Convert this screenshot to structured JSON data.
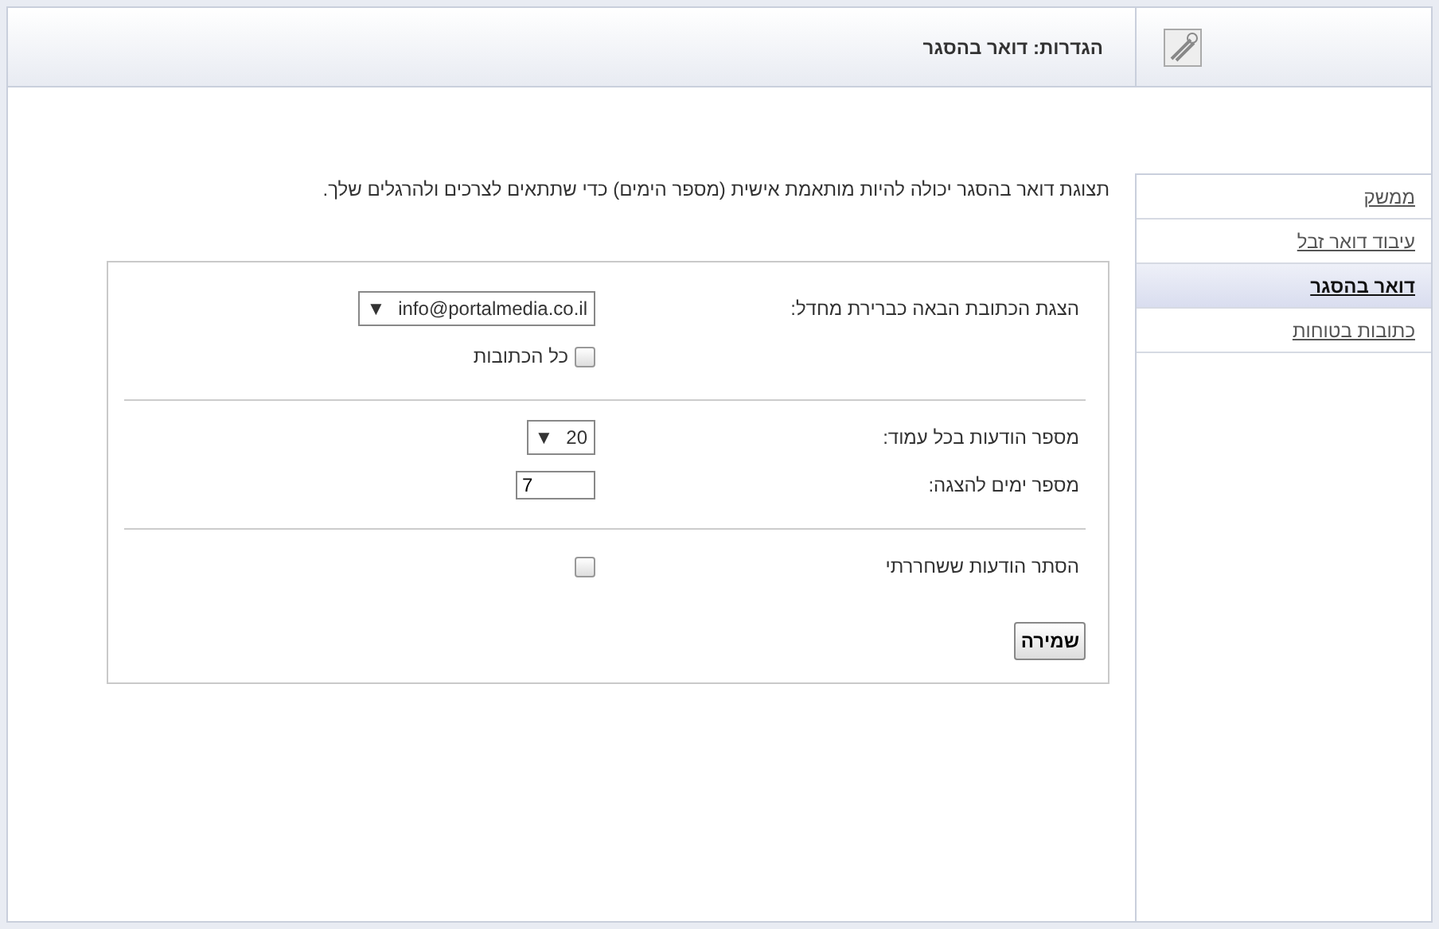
{
  "header": {
    "title": "הגדרות: דואר בהסגר"
  },
  "sidebar": {
    "items": [
      {
        "label": "ממשק",
        "selected": false
      },
      {
        "label": "עיבוד דואר זבל",
        "selected": false
      },
      {
        "label": "דואר בהסגר",
        "selected": true
      },
      {
        "label": "כתובות בטוחות",
        "selected": false
      }
    ]
  },
  "intro": "תצוגת דואר בהסגר יכולה להיות מותאמת אישית (מספר הימים) כדי שתתאים לצרכים ולהרגלים שלך.",
  "form": {
    "sections": [
      [
        {
          "kind": "select",
          "label": "הצגת הכתובת הבאה כברירת מחדל:",
          "value": "info@portalmedia.co.il",
          "arrow": "▼"
        },
        {
          "kind": "checkbox",
          "text": "כל הכתובות",
          "checked": false
        }
      ],
      [
        {
          "kind": "select",
          "label": "מספר הודעות בכל עמוד:",
          "value": "20",
          "arrow": "▼"
        },
        {
          "kind": "text",
          "label": "מספר ימים להצגה:",
          "value": "7"
        }
      ],
      [
        {
          "kind": "checkbox",
          "label": "הסתר הודעות ששחררתי",
          "checked": false
        }
      ]
    ],
    "save_button": "שמירה"
  }
}
